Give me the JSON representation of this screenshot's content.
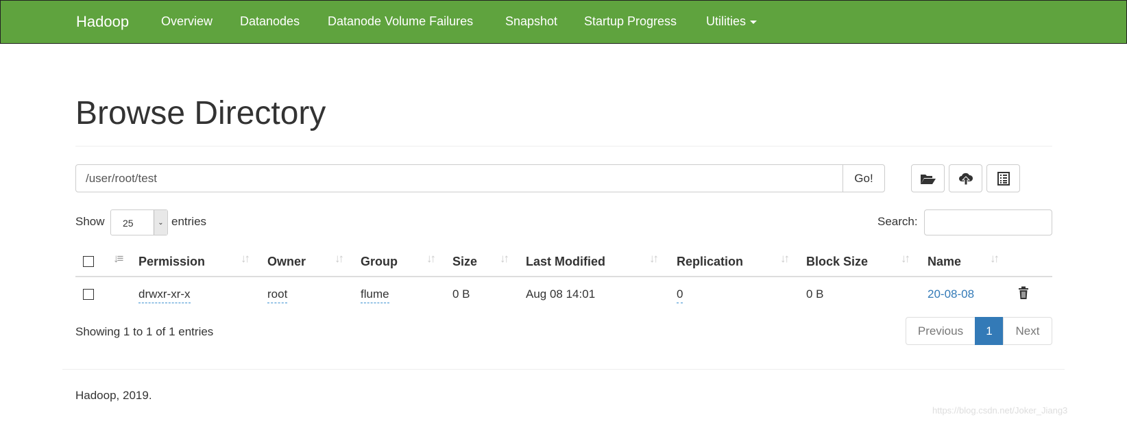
{
  "navbar": {
    "brand": "Hadoop",
    "items": [
      "Overview",
      "Datanodes",
      "Datanode Volume Failures",
      "Snapshot",
      "Startup Progress",
      "Utilities"
    ],
    "color": "#5fa33e"
  },
  "page_title": "Browse Directory",
  "path_input": {
    "value": "/user/root/test",
    "go_label": "Go!"
  },
  "toolbar": {
    "icons": [
      "folder-open-icon",
      "cloud-upload-icon",
      "list-icon"
    ]
  },
  "length": {
    "show": "Show",
    "value": "25",
    "entries": "entries"
  },
  "search": {
    "label": "Search:",
    "value": ""
  },
  "table": {
    "headers": [
      "Permission",
      "Owner",
      "Group",
      "Size",
      "Last Modified",
      "Replication",
      "Block Size",
      "Name"
    ],
    "rows": [
      {
        "permission": "drwxr-xr-x",
        "owner": "root",
        "group": "flume",
        "size": "0 B",
        "last_modified": "Aug 08 14:01",
        "replication": "0",
        "block_size": "0 B",
        "name": "20-08-08"
      }
    ]
  },
  "info": "Showing 1 to 1 of 1 entries",
  "pagination": {
    "previous": "Previous",
    "current": "1",
    "next": "Next",
    "accent": "#337ab7"
  },
  "footer": "Hadoop, 2019.",
  "watermark": "https://blog.csdn.net/Joker_Jiang3"
}
